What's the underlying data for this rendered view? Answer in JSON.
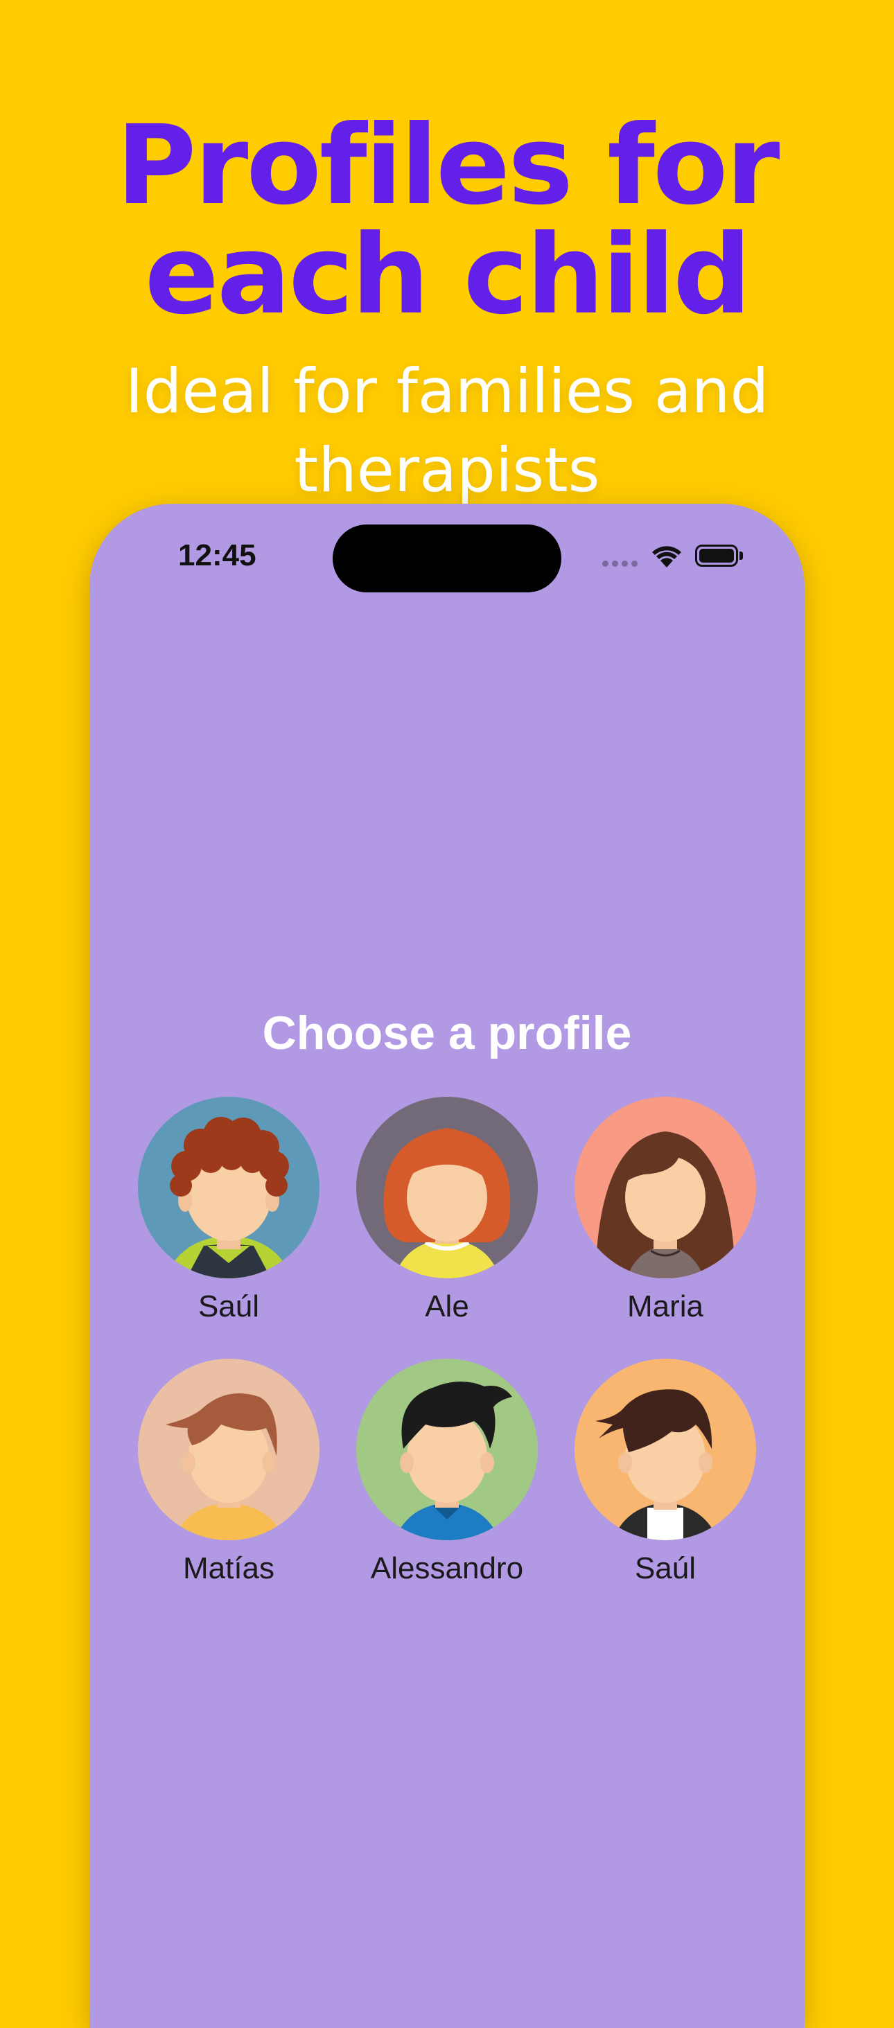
{
  "headline": {
    "line1": "Profiles for",
    "line2": "each child",
    "color": "#6320E8"
  },
  "subhead": {
    "line1": "Ideal for families and",
    "line2": "therapists"
  },
  "background_color": "#FFCC00",
  "phone": {
    "screen_color": "#B199E4",
    "status_bar": {
      "time": "12:45",
      "icons": [
        "cellular-signal-icon",
        "wifi-icon",
        "battery-icon"
      ]
    }
  },
  "profile_picker": {
    "title": "Choose a profile",
    "profiles": [
      {
        "name": "Saúl",
        "avatar": "boy-curly-red-hair-avatar",
        "bg": "#5E9AB8"
      },
      {
        "name": "Ale",
        "avatar": "girl-orange-hair-avatar",
        "bg": "#726979"
      },
      {
        "name": "Maria",
        "avatar": "girl-long-brown-hair-avatar",
        "bg": "#F89A84"
      },
      {
        "name": "Matías",
        "avatar": "boy-brown-hair-avatar",
        "bg": "#EABFA4"
      },
      {
        "name": "Alessandro",
        "avatar": "boy-black-hair-avatar",
        "bg": "#A1C884"
      },
      {
        "name": "Saúl",
        "avatar": "boy-dark-brown-hair-avatar",
        "bg": "#F9B671"
      }
    ]
  }
}
